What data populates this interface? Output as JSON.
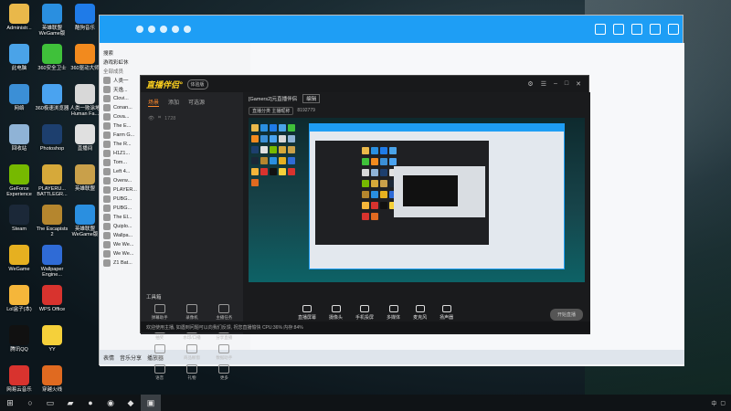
{
  "desktop_icons": [
    {
      "label": "Administr...",
      "color": "#e9b84a"
    },
    {
      "label": "英雄联盟 WeGame版",
      "color": "#2a8fe0"
    },
    {
      "label": "酷狗音乐",
      "color": "#1f7be8"
    },
    {
      "label": "此电脑",
      "color": "#4aa3e8"
    },
    {
      "label": "360安全卫士",
      "color": "#3fc13a"
    },
    {
      "label": "360驱动大师",
      "color": "#f28a1e"
    },
    {
      "label": "网络",
      "color": "#3b8fd6"
    },
    {
      "label": "360极速浏览器",
      "color": "#4aa3f0"
    },
    {
      "label": "人类一败涂地 Human Fa...",
      "color": "#d8d8d8"
    },
    {
      "label": "回收站",
      "color": "#8fb3d6"
    },
    {
      "label": "Photoshop",
      "color": "#1d3f6e"
    },
    {
      "label": "直播间",
      "color": "#e0e0e0"
    },
    {
      "label": "GeForce Experience",
      "color": "#76b900"
    },
    {
      "label": "PLAYERU... BATTLEGR...",
      "color": "#d6a93a"
    },
    {
      "label": "英雄联盟",
      "color": "#c9a04a"
    },
    {
      "label": "Steam",
      "color": "#1b2838"
    },
    {
      "label": "The Escapists 2",
      "color": "#b5862e"
    },
    {
      "label": "英雄联盟 WeGame版",
      "color": "#2a8fe0"
    },
    {
      "label": "WeGame",
      "color": "#e6b020"
    },
    {
      "label": "Wallpaper Engine...",
      "color": "#2f6bd6"
    },
    {
      "label": "",
      "color": "#000000"
    },
    {
      "label": "Lol盒子(本)",
      "color": "#f5b63a"
    },
    {
      "label": "WPS Office",
      "color": "#d8332e"
    },
    {
      "label": "",
      "color": "#000000"
    },
    {
      "label": "腾讯QQ",
      "color": "#111111"
    },
    {
      "label": "YY",
      "color": "#f5d03a"
    },
    {
      "label": "",
      "color": "#000000"
    },
    {
      "label": "网易云音乐",
      "color": "#d8332e"
    },
    {
      "label": "穿越火线",
      "color": "#e06a20"
    }
  ],
  "qq": {
    "search_placeholder": "搜索",
    "group_label": "游戏彩虹休",
    "list_header": "全部成员",
    "members": [
      "人类一",
      "天逸...",
      "Clovi...",
      "Conan...",
      "Cova...",
      "The E...",
      "Farm G...",
      "The R...",
      "H1Z1...",
      "Tom...",
      "Left 4...",
      "Overw...",
      "PLAYER...",
      "PUBG...",
      "PUBG...",
      "The El...",
      "Quiplo...",
      "Wallpa...",
      "We We...",
      "We We...",
      "Z1 Bat..."
    ],
    "bottom_items": [
      "表情",
      "音乐分享",
      "播放器"
    ]
  },
  "zb": {
    "logo": "直播伴侣°",
    "badge": "体验版",
    "tabs": [
      "场景",
      "添加",
      "可选源"
    ],
    "scene_rows": [
      "1728"
    ],
    "main_title": "[Gamers2]元直播伴侣",
    "main_tag": "编辑",
    "main_sub": "直播分类  主播昵称",
    "main_id": "8192779",
    "tools_title": "工具箱",
    "tools": [
      "弹幕助手",
      "录像机",
      "主播任务",
      "抽奖",
      "水印/口播",
      "分享直播",
      "拍照",
      "商品橱窗",
      "数据助手",
      "语音",
      "礼物",
      "更多"
    ],
    "controls": [
      "直播屏幕",
      "摄像头",
      "手机投屏",
      "多媒体",
      "麦克风",
      "扬声器"
    ],
    "golive": "开始直播",
    "status": "欢迎使用主播, 如遇到问题可以向我们反馈, 祝您直播愉快 CPU:36% 内存:84%"
  },
  "taskbar": {
    "time": "",
    "tray": "中"
  }
}
